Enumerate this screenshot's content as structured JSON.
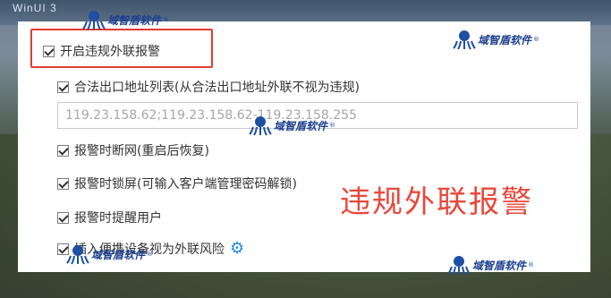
{
  "background_text": "WinUI 3",
  "options": {
    "main": {
      "label": "开启违规外联报警",
      "checked": true
    },
    "legal_exit": {
      "label": "合法出口地址列表(从合法出口地址外联不视为违规)",
      "checked": true
    },
    "ip_list": {
      "value": "119.23.158.62;119.23.158.62-119.23.158.255"
    },
    "disconnect": {
      "label": "报警时断网(重启后恢复)",
      "checked": true
    },
    "lock_screen": {
      "label": "报警时锁屏(可输入客户端管理密码解锁)",
      "checked": true
    },
    "notify_user": {
      "label": "报警时提醒用户",
      "checked": true
    },
    "portable_device": {
      "label": "插入便携设备视为外联风险",
      "checked": true
    }
  },
  "annotation": "违规外联报警",
  "watermark": {
    "text": "域智盾软件",
    "registered": "®"
  },
  "colors": {
    "highlight": "#e23b32",
    "annotation": "#e8483c",
    "gear": "#1e88e5"
  },
  "icons": {
    "settings": "gear-icon",
    "octopus_logo": "octopus-logo-icon"
  }
}
